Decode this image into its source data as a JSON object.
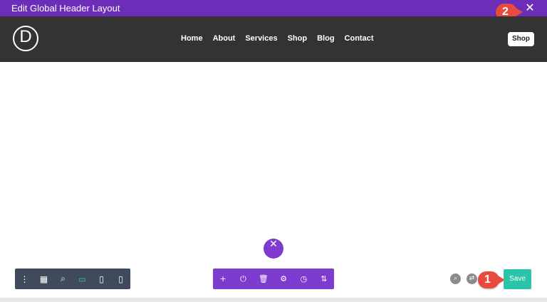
{
  "titlebar": {
    "title": "Edit Global Header Layout",
    "close_symbol": "✕"
  },
  "header": {
    "logo_letter": "D",
    "nav": [
      "Home",
      "About",
      "Services",
      "Shop",
      "Blog",
      "Contact"
    ],
    "shop_button": "Shop"
  },
  "fab": {
    "close_symbol": "✕"
  },
  "toolbar_left": {
    "buttons": [
      {
        "icon": "more-vertical-icon",
        "glyph": "⋮"
      },
      {
        "icon": "layout-icon",
        "glyph": "▦"
      },
      {
        "icon": "search-icon",
        "glyph": "⌕"
      },
      {
        "icon": "desktop-icon",
        "glyph": "▭"
      },
      {
        "icon": "tablet-icon",
        "glyph": "▯"
      },
      {
        "icon": "phone-icon",
        "glyph": "▯"
      }
    ]
  },
  "toolbar_center": {
    "buttons": [
      {
        "icon": "add-icon",
        "glyph": "+"
      },
      {
        "icon": "power-icon",
        "glyph": "⏻"
      },
      {
        "icon": "trash-icon",
        "glyph": "🗑"
      },
      {
        "icon": "settings-icon",
        "glyph": "⚙"
      },
      {
        "icon": "history-icon",
        "glyph": "◷"
      },
      {
        "icon": "sort-icon",
        "glyph": "⇅"
      }
    ]
  },
  "controls_right": {
    "search_glyph": "⌕",
    "portability_glyph": "⇄",
    "save_label": "Save"
  },
  "annotations": {
    "step1": "1",
    "step2": "2"
  },
  "colors": {
    "titlebar": "#6c2eb9",
    "header_bg": "#333333",
    "toolbar_left_bg": "#3f4b5b",
    "toolbar_center_bg": "#7e3bd0",
    "save_bg": "#29c4a9",
    "callout_red": "#e84b3d"
  }
}
